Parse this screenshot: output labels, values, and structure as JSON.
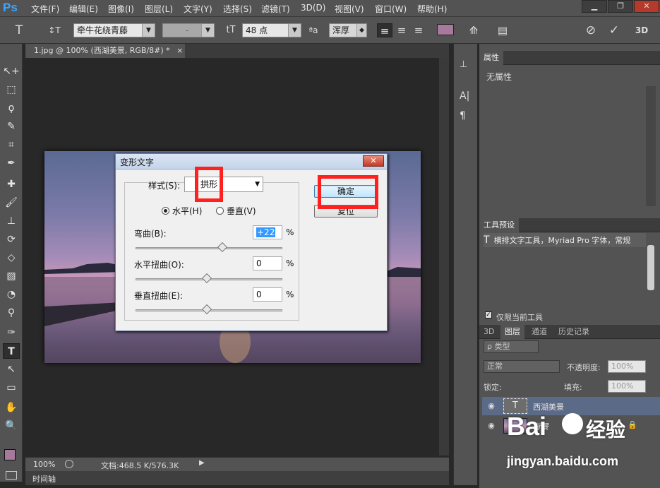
{
  "app": {
    "logo": "Ps"
  },
  "menu": [
    "文件(F)",
    "编辑(E)",
    "图像(I)",
    "图层(L)",
    "文字(Y)",
    "选择(S)",
    "滤镜(T)",
    "3D(D)",
    "视图(V)",
    "窗口(W)",
    "帮助(H)"
  ],
  "window_controls": {
    "minimize": "▁",
    "restore": "❐",
    "close": "✕"
  },
  "options": {
    "tool_icon": "T",
    "orient_icon": "↕T",
    "font_family": "牵牛花绕青藤",
    "font_style": "-",
    "size_icon": "tT",
    "font_size": "48 点",
    "aa_icon": "ªa",
    "antialias": "浑厚",
    "align_left": "≡",
    "align_center": "≡",
    "align_right": "≡",
    "color": "#a7799d",
    "warp_icon": "⟰",
    "panel_icon": "▤",
    "cancel_icon": "⊘",
    "commit_icon": "✓",
    "threed": "3D"
  },
  "tools": [
    "↖+",
    "⬚",
    "ϙ",
    "✎",
    "⌗",
    "✒",
    "✚",
    "🖌",
    "⊥",
    "⟳",
    "◇",
    "▧",
    "◔",
    "⚲",
    "✑",
    "T",
    "↖",
    "▭",
    "✋",
    "🔍"
  ],
  "colors": {
    "foreground": "#a7799d",
    "background": "#ffffff"
  },
  "document": {
    "tab_title": "1.jpg @ 100% (西湖美景, RGB/8#) *",
    "tab_close": "×",
    "zoom": "100%",
    "doc_info": "文档:468.5 K/576.3K",
    "timeline": "时间轴"
  },
  "dialog": {
    "title": "变形文字",
    "close": "✕",
    "style_label": "样式(S):",
    "style_value": "拱形",
    "orient_h": "水平(H)",
    "orient_v": "垂直(V)",
    "bend_label": "弯曲(B):",
    "bend_value": "+22",
    "hdist_label": "水平扭曲(O):",
    "hdist_value": "0",
    "vdist_label": "垂直扭曲(E):",
    "vdist_value": "0",
    "percent": "%",
    "ok": "确定",
    "reset": "复位",
    "bend_level": 0.61,
    "hdist_level": 0.5,
    "vdist_level": 0.5
  },
  "properties": {
    "tab": "属性",
    "empty": "无属性"
  },
  "tool_presets": {
    "tab": "工具预设",
    "item": "横排文字工具，Myriad Pro 字体，常规",
    "current_only": "仅限当前工具"
  },
  "layers_panel": {
    "tabs": [
      "3D",
      "图层",
      "通道",
      "历史记录"
    ],
    "filter": "ρ 类型",
    "blend_mode": "正常",
    "opacity_label": "不透明度:",
    "opacity": "100%",
    "lock_label": "锁定:",
    "fill_label": "填充:",
    "fill": "100%",
    "layers": [
      {
        "name": "西湖美景",
        "thumb": "T"
      },
      {
        "name": "背景",
        "thumb": ""
      }
    ],
    "footer_icons": [
      "⛓",
      "fx",
      "◘",
      "◐",
      "▭",
      "▣",
      "🗑"
    ]
  },
  "watermark": {
    "text": "Bai",
    "text2": "经验",
    "url": "jingyan.baidu.com"
  }
}
